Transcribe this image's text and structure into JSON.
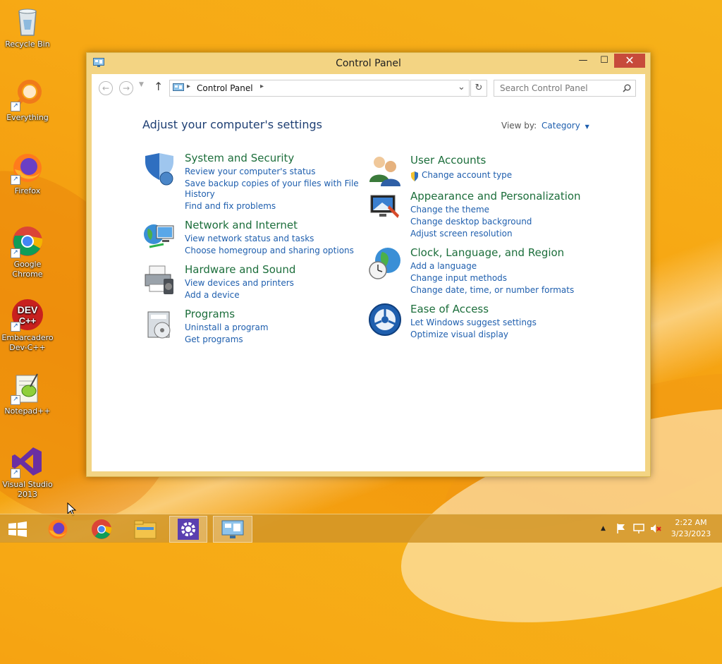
{
  "desktop": {
    "icons": [
      {
        "label": "Recycle Bin"
      },
      {
        "label": "Everything"
      },
      {
        "label": "Firefox"
      },
      {
        "label": "Google Chrome"
      },
      {
        "label": "Embarcadero Dev-C++"
      },
      {
        "label": "Notepad++"
      },
      {
        "label": "Visual Studio 2013"
      }
    ]
  },
  "window": {
    "title": "Control Panel",
    "minimize": "—",
    "maximize": "☐",
    "close": "✕"
  },
  "address_bar": {
    "path": "Control Panel",
    "search_placeholder": "Search Control Panel"
  },
  "main": {
    "heading": "Adjust your computer's settings",
    "view_by_label": "View by:",
    "view_by_value": "Category",
    "left_categories": [
      {
        "title": "System and Security",
        "links": [
          "Review your computer's status",
          "Save backup copies of your files with File",
          "History",
          "Find and fix problems"
        ]
      },
      {
        "title": "Network and Internet",
        "links": [
          "View network status and tasks",
          "Choose homegroup and sharing options"
        ]
      },
      {
        "title": "Hardware and Sound",
        "links": [
          "View devices and printers",
          "Add a device"
        ]
      },
      {
        "title": "Programs",
        "links": [
          "Uninstall a program",
          "Get programs"
        ]
      }
    ],
    "right_categories": [
      {
        "title": "User Accounts",
        "links": [
          "Change account type"
        ]
      },
      {
        "title": "Appearance and Personalization",
        "links": [
          "Change the theme",
          "Change desktop background",
          "Adjust screen resolution"
        ]
      },
      {
        "title": "Clock, Language, and Region",
        "links": [
          "Add a language",
          "Change input methods",
          "Change date, time, or number formats"
        ]
      },
      {
        "title": "Ease of Access",
        "links": [
          "Let Windows suggest settings",
          "Optimize visual display"
        ]
      }
    ]
  },
  "taskbar": {
    "time": "2:22 AM",
    "date": "3/23/2023"
  },
  "colors": {
    "category_title": "#1c6e3b",
    "link": "#1f5fae",
    "heading": "#1e3f73",
    "close_button": "#c74b3b"
  }
}
